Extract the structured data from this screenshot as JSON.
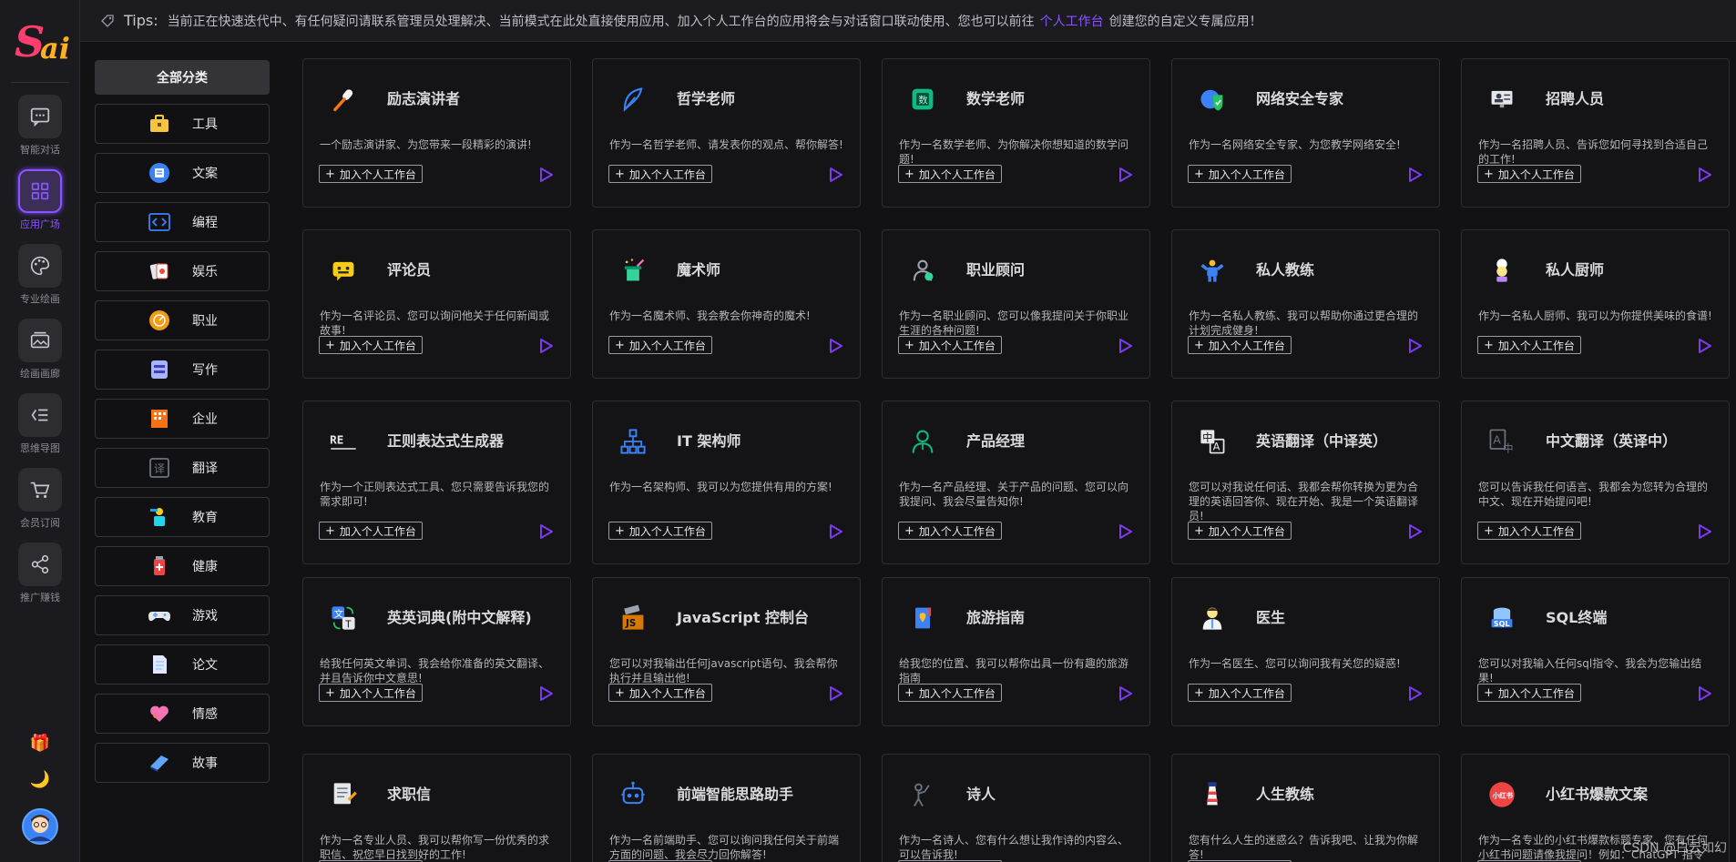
{
  "logo_text": "Sai",
  "rail": [
    {
      "label": "智能对话",
      "icon": "chat-icon"
    },
    {
      "label": "应用广场",
      "icon": "apps-grid-icon",
      "active": true
    },
    {
      "label": "专业绘画",
      "icon": "palette-icon"
    },
    {
      "label": "绘画画廊",
      "icon": "gallery-icon"
    },
    {
      "label": "思维导图",
      "icon": "mindmap-icon"
    },
    {
      "label": "会员订阅",
      "icon": "cart-icon"
    },
    {
      "label": "推广赚钱",
      "icon": "share-icon"
    }
  ],
  "tips": {
    "title": "Tips:",
    "text_before": "当前正在快速迭代中、有任何疑问请联系管理员处理解决、当前模式在此处直接使用应用、加入个人工作台的应用将会与对话窗口联动使用、您也可以前往",
    "link": "个人工作台",
    "text_after": "创建您的自定义专属应用！"
  },
  "categories": [
    {
      "label": "全部分类",
      "active": true
    },
    {
      "label": "工具",
      "icon": "toolbox-icon",
      "color": "#f5c542"
    },
    {
      "label": "文案",
      "icon": "document-icon",
      "color": "#3b82f6"
    },
    {
      "label": "编程",
      "icon": "code-icon",
      "color": "#3b82f6"
    },
    {
      "label": "娱乐",
      "icon": "cards-icon",
      "color": "#e74c3c"
    },
    {
      "label": "职业",
      "icon": "briefcase-icon",
      "color": "#f39c12"
    },
    {
      "label": "写作",
      "icon": "writing-icon",
      "color": "#a5b4fc"
    },
    {
      "label": "企业",
      "icon": "building-icon",
      "color": "#f97316"
    },
    {
      "label": "翻译",
      "icon": "translate-icon",
      "color": "#6b7280"
    },
    {
      "label": "教育",
      "icon": "teacher-icon",
      "color": "#22d3ee"
    },
    {
      "label": "健康",
      "icon": "medicine-icon",
      "color": "#ef4444"
    },
    {
      "label": "游戏",
      "icon": "gamepad-icon",
      "color": "#60a5fa"
    },
    {
      "label": "论文",
      "icon": "paper-icon",
      "color": "#93c5fd"
    },
    {
      "label": "情感",
      "icon": "heart-icon",
      "color": "#f472b6"
    },
    {
      "label": "故事",
      "icon": "book-icon",
      "color": "#60a5fa"
    }
  ],
  "add_label": "加入个人工作台",
  "cards": [
    {
      "title": "励志演讲者",
      "desc": "一个励志演讲家、为您带来一段精彩的演讲!",
      "icon": "microphone-icon",
      "color": "#f97316"
    },
    {
      "title": "哲学老师",
      "desc": "作为一名哲学老师、请发表你的观点、帮你解答!",
      "icon": "feather-icon",
      "color": "#3b82f6"
    },
    {
      "title": "数学老师",
      "desc": "作为一名数学老师、为你解决你想知道的数学问题!",
      "icon": "math-book-icon",
      "color": "#10b981"
    },
    {
      "title": "网络安全专家",
      "desc": "作为一名网络安全专家、为您教学网络安全!",
      "icon": "shield-globe-icon",
      "color": "#3b82f6"
    },
    {
      "title": "招聘人员",
      "desc": "作为一名招聘人员、告诉您如何寻找到合适自己的工作!",
      "icon": "recruiter-icon",
      "color": "#9ca3af"
    },
    {
      "title": "评论员",
      "desc": "作为一名评论员、您可以询问他关于任何新闻或故事!",
      "icon": "comment-icon",
      "color": "#facc15"
    },
    {
      "title": "魔术师",
      "desc": "作为一名魔术师、我会教会你神奇的魔术!",
      "icon": "magic-hat-icon",
      "color": "#34d399"
    },
    {
      "title": "职业顾问",
      "desc": "作为一名职业顾问、您可以像我提问关于你职业生涯的各种问题!",
      "icon": "advisor-icon",
      "color": "#9ca3af"
    },
    {
      "title": "私人教练",
      "desc": "作为一名私人教练、我可以帮助你通过更合理的计划完成健身!",
      "icon": "fitness-icon",
      "color": "#3b82f6"
    },
    {
      "title": "私人厨师",
      "desc": "作为一名私人厨师、我可以为你提供美味的食谱!",
      "icon": "chef-icon",
      "color": "#c084fc"
    },
    {
      "title": "正则表达式生成器",
      "desc": "作为一个正则表达式工具、您只需要告诉我您的需求即可!",
      "icon": "regex-icon",
      "color": "#e5e7eb"
    },
    {
      "title": "IT 架构师",
      "desc": "作为一名架构师、我可以为您提供有用的方案!",
      "icon": "network-icon",
      "color": "#3b82f6"
    },
    {
      "title": "产品经理",
      "desc": "作为一名产品经理、关于产品的问题、您可以向我提问、我会尽量告知你!",
      "icon": "person-icon",
      "color": "#10b981"
    },
    {
      "title": "英语翻译（中译英）",
      "desc": "您可以对我说任何话、我都会帮你转换为更为合理的英语回答你、现在开始、我是一个英语翻译员!",
      "icon": "translate-zh-en-icon",
      "color": "#e5e7eb"
    },
    {
      "title": "中文翻译（英译中）",
      "desc": "您可以告诉我任何语言、我都会为您转为合理的中文、现在开始提问吧!",
      "icon": "translate-en-zh-icon",
      "color": "#6b7280"
    },
    {
      "title": "英英词典(附中文解释)",
      "desc": "给我任何英文单词、我会给你准备的英文翻译、并且告诉你中文意思!",
      "icon": "dictionary-icon",
      "color": "#3b82f6"
    },
    {
      "title": "JavaScript 控制台",
      "desc": "您可以对我输出任何javascript语句、我会帮你执行并且输出他!",
      "icon": "js-icon",
      "color": "#d97706"
    },
    {
      "title": "旅游指南",
      "desc": "给我您的位置、我可以帮你出具一份有趣的旅游指南",
      "icon": "guide-icon",
      "color": "#3b82f6"
    },
    {
      "title": "医生",
      "desc": "作为一名医生、您可以询问我有关您的疑惑!",
      "icon": "doctor-icon",
      "color": "#60a5fa"
    },
    {
      "title": "SQL终端",
      "desc": "您可以对我输入任何sql指令、我会为您输出结果!",
      "icon": "sql-icon",
      "color": "#3b82f6"
    },
    {
      "title": "求职信",
      "desc": "作为一名专业人员、我可以帮你写一份优秀的求职信、祝您早日找到好的工作!",
      "icon": "letter-icon",
      "color": "#e5e7eb"
    },
    {
      "title": "前端智能思路助手",
      "desc": "作为一名前端助手、您可以询问我任何关于前端方面的问题、我会尽力回你解答!",
      "icon": "robot-icon",
      "color": "#3b82f6"
    },
    {
      "title": "诗人",
      "desc": "作为一名诗人、您有什么想让我作诗的内容么、可以告诉我!",
      "icon": "poet-icon",
      "color": "#6b7280"
    },
    {
      "title": "人生教练",
      "desc": "您有什么人生的迷惑么？告诉我吧、让我为你解答!",
      "icon": "lighthouse-icon",
      "color": "#ef4444"
    },
    {
      "title": "小红书爆款文案",
      "desc": "作为一名专业的小红书爆款标题专家、您有任何小红书问题请像我提问！例如：ChatGPT 指令学",
      "icon": "xiaohongshu-icon",
      "color": "#ef4444"
    }
  ],
  "watermark": "CSDN @白云如幻"
}
